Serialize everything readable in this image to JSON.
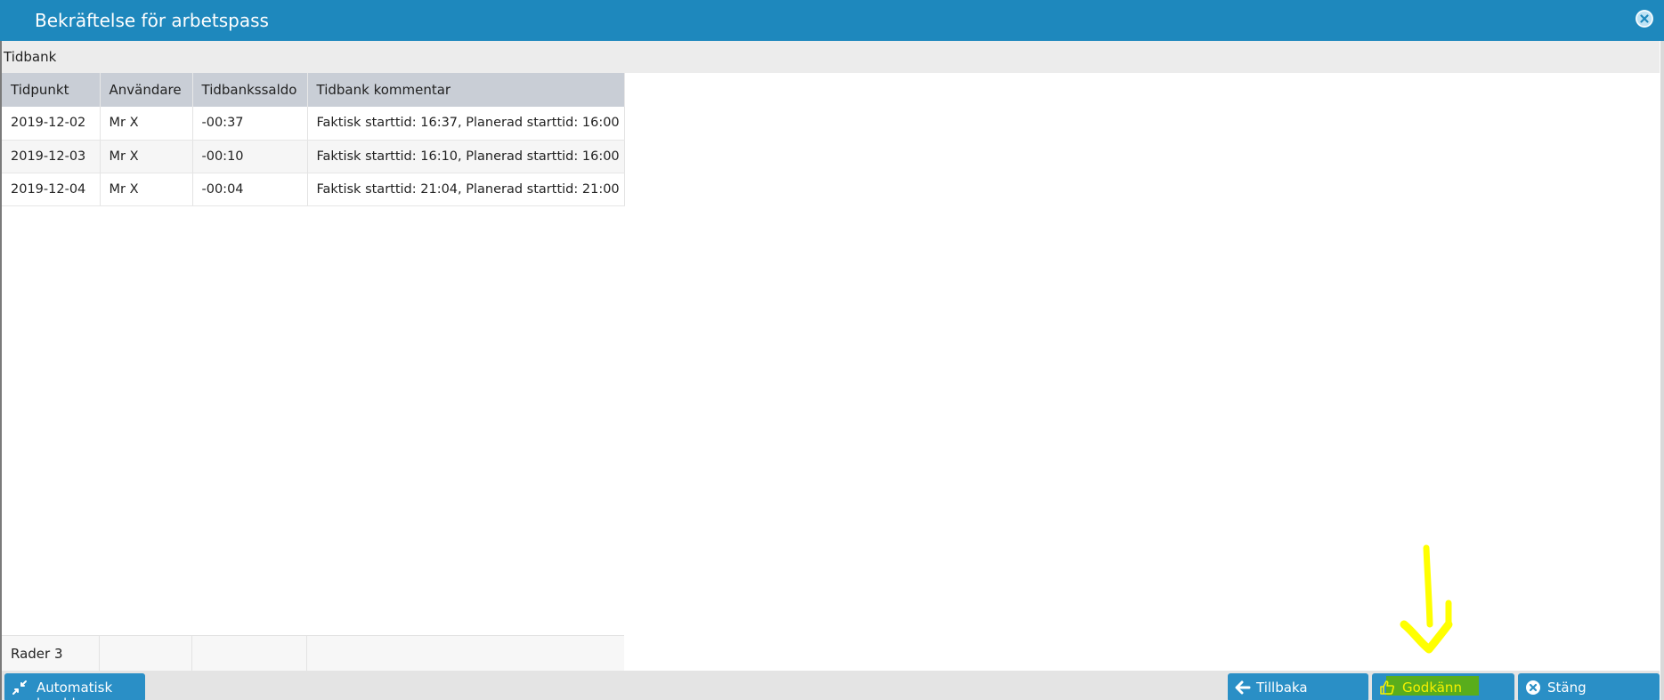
{
  "dialog": {
    "title": "Bekräftelse för arbetspass",
    "close_icon": "close-circle-icon"
  },
  "section": {
    "title": "Tidbank"
  },
  "table": {
    "columns": [
      "Tidpunkt",
      "Användare",
      "Tidbankssaldo",
      "Tidbank kommentar"
    ],
    "rows": [
      [
        "2019-12-02",
        "Mr X",
        "-00:37",
        "Faktisk starttid: 16:37, Planerad starttid: 16:00"
      ],
      [
        "2019-12-03",
        "Mr X",
        "-00:10",
        "Faktisk starttid: 16:10, Planerad starttid: 16:00"
      ],
      [
        "2019-12-04",
        "Mr X",
        "-00:04",
        "Faktisk starttid: 21:04, Planerad starttid: 21:00"
      ]
    ],
    "footer": {
      "row_count": "Rader 3"
    }
  },
  "buttons": {
    "auto_width": {
      "label": "Automatisk bredd",
      "icon": "compress-arrows-icon"
    },
    "back": {
      "label": "Tillbaka",
      "icon": "arrow-left-icon"
    },
    "approve": {
      "label": "Godkänn",
      "icon": "thumbs-up-icon"
    },
    "close": {
      "label": "Stäng",
      "icon": "close-circle-icon"
    }
  },
  "colors": {
    "titlebar": "#1e88bd",
    "button": "#2a8fc6",
    "header_row": "#c9ced6",
    "annotation_arrow": "#ffff00",
    "approve_highlight": "#59ad1c"
  }
}
